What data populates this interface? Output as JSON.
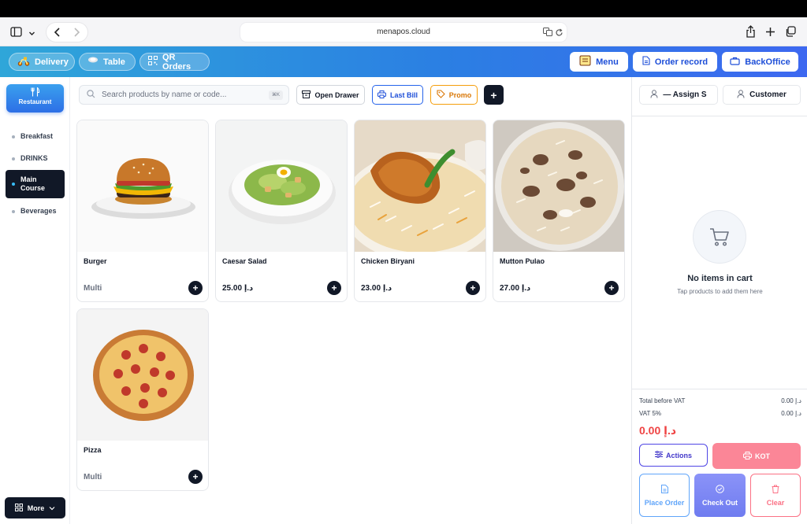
{
  "browser": {
    "url": "menapos.cloud",
    "icons": [
      "sidebar-icon",
      "chevron-down-icon",
      "back-icon",
      "forward-icon",
      "translate-icon",
      "reload-icon",
      "share-icon",
      "new-tab-icon",
      "tabs-icon"
    ]
  },
  "topbar": {
    "modes": [
      {
        "label": "Delivery",
        "icon": "scooter-icon"
      },
      {
        "label": "Table",
        "icon": "table-icon"
      },
      {
        "label": "QR Orders",
        "icon": "qr-icon"
      }
    ],
    "menu_label": "Menu",
    "order_record_label": "Order record",
    "backoffice_label": "BackOffice"
  },
  "sidebar": {
    "restaurant_label": "Restaurant",
    "categories": [
      {
        "label": "Breakfast",
        "active": false
      },
      {
        "label": "DRINKS",
        "active": false
      },
      {
        "label": "Main Course",
        "active": true
      },
      {
        "label": "Beverages",
        "active": false
      }
    ],
    "more_label": "More"
  },
  "toolbar": {
    "search_placeholder": "Search products by name or code...",
    "search_shortcut": "⌘K",
    "open_drawer_label": "Open Drawer",
    "last_bill_label": "Last Bill",
    "promo_label": "Promo",
    "add_label": "+"
  },
  "products": [
    {
      "name": "Burger",
      "price": "Multi"
    },
    {
      "name": "Caesar Salad",
      "price": "25.00 د.إ"
    },
    {
      "name": "Chicken Biryani",
      "price": "23.00 د.إ"
    },
    {
      "name": "Mutton Pulao",
      "price": "27.00 د.إ"
    },
    {
      "name": "Pizza",
      "price": "Multi"
    }
  ],
  "cart": {
    "assign_label": "— Assign S",
    "customer_label": "Customer",
    "empty_title": "No items in cart",
    "empty_subtitle": "Tap products to add them here",
    "total_before_vat_label": "Total before VAT",
    "total_before_vat_value": "0.00 د.إ",
    "vat_label": "VAT 5%",
    "vat_value": "0.00 د.إ",
    "total_value": "0.00 د.إ",
    "actions_label": "Actions",
    "kot_label": "KOT",
    "place_order_label": "Place Order",
    "checkout_label": "Check Out",
    "clear_label": "Clear"
  },
  "colors": {
    "accent": "#2b7fe3",
    "dark": "#111827",
    "danger": "#ef4444",
    "promo": "#f59e0b"
  }
}
